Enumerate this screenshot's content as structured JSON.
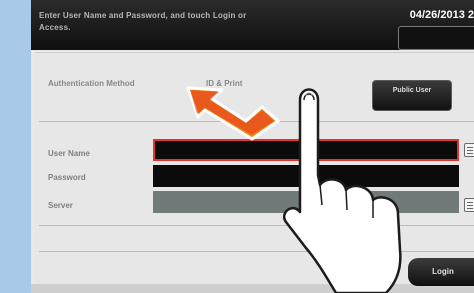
{
  "header": {
    "prompt": "Enter User Name and Password, and touch Login or Access.",
    "datetime": "04/26/2013 2"
  },
  "auth": {
    "method_label": "Authentication Method",
    "method_value": "ID & Print",
    "public_user_label": "Public User"
  },
  "form": {
    "user_name_label": "User Name",
    "password_label": "Password",
    "server_label": "Server"
  },
  "actions": {
    "login_label": "Login"
  },
  "colors": {
    "background": "#a9c9e8",
    "focus_border": "#e1352f",
    "arrow": "#f08a1c"
  },
  "icons": [
    "keyboard-icon",
    "swipe-arrow-icon",
    "pointing-hand-icon"
  ]
}
